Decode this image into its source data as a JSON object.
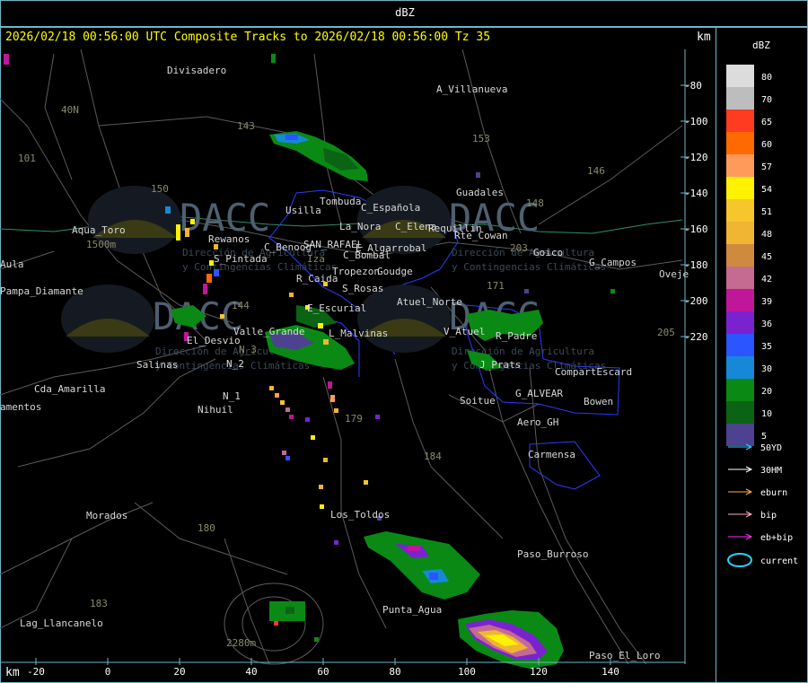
{
  "window": {
    "title": "dBZ"
  },
  "header": {
    "text": "2026/02/18 00:56:00 UTC Composite Tracks to 2026/02/18 00:56:00 Tz 35",
    "km_top": "km",
    "km_bottom": "km"
  },
  "axes": {
    "y_ticks": [
      "-80",
      "-100",
      "-120",
      "-140",
      "-160",
      "-180",
      "-200",
      "-220"
    ],
    "x_ticks": [
      "-20",
      "0",
      "20",
      "40",
      "60",
      "80",
      "100",
      "120",
      "140"
    ]
  },
  "watermark": {
    "name": "DACC",
    "line1": "Dirección de Agricultura",
    "line2": "y Contingencias Climáticas"
  },
  "place_labels": [
    "Divisadero",
    "A_Villanueva",
    "Guadales",
    "La_Nora",
    "C_Española",
    "C_Elena",
    "Requillin",
    "Rte_Cowan",
    "Usilla",
    "Tombuda",
    "Aqua_Toro",
    "Rewanos",
    "S_Pintada",
    "C_Benoog",
    "SAN_RAFAEL",
    "E_Algarrobal",
    "C_Bombal",
    "Goico",
    "G_Campos",
    "Oveje",
    "Pampa_Diamante",
    "Aula",
    "Tropezon",
    "Goudge",
    "R_Caida",
    "S_Rosas",
    "Atuel_Norte",
    "E_Escurial",
    "Valle_Grande",
    "El_Desvio",
    "L_Malvinas",
    "V_Atuel",
    "R_Padre",
    "J_Prats",
    "CompartEscard",
    "Salinas",
    "N_2",
    "N_1",
    "Cda_Amarilla",
    "amentos",
    "Nihuil",
    "G_ALVEAR",
    "Soitue",
    "Bowen",
    "Aero_GH",
    "Carmensa",
    "Morados",
    "Los_Toldos",
    "Paso_Burroso",
    "Punta_Agua",
    "Lag_Llancanelo",
    "Paso_El_Loro",
    "40N",
    "101",
    "153",
    "146",
    "143",
    "171",
    "205",
    "184",
    "180",
    "183",
    "150",
    "148",
    "203",
    "144",
    "179",
    "2280m",
    "1500m",
    "N_3",
    "Iza"
  ],
  "legend": {
    "title": "dBZ",
    "bins": [
      {
        "label": "80",
        "color": "#dcdcdc"
      },
      {
        "label": "70",
        "color": "#bdbdbd"
      },
      {
        "label": "65",
        "color": "#ff3b22"
      },
      {
        "label": "60",
        "color": "#ff6a00"
      },
      {
        "label": "57",
        "color": "#ff9a5a"
      },
      {
        "label": "54",
        "color": "#fff200"
      },
      {
        "label": "51",
        "color": "#f7c52c"
      },
      {
        "label": "48",
        "color": "#f0b533"
      },
      {
        "label": "45",
        "color": "#cf8a3e"
      },
      {
        "label": "42",
        "color": "#c56a90"
      },
      {
        "label": "39",
        "color": "#c0169a"
      },
      {
        "label": "36",
        "color": "#7a22d0"
      },
      {
        "label": "35",
        "color": "#2a55ff"
      },
      {
        "label": "30",
        "color": "#1688d8"
      },
      {
        "label": "20",
        "color": "#0a8a14"
      },
      {
        "label": "10",
        "color": "#0b6414"
      },
      {
        "label": "5",
        "color": "#4e4290"
      }
    ],
    "tracks": [
      {
        "label": "50YD",
        "color": "#26d4ff"
      },
      {
        "label": "30HM",
        "color": "#ffffff"
      },
      {
        "label": "eburn",
        "color": "#ffb23a"
      },
      {
        "label": "bip",
        "color": "#ffb0c8"
      },
      {
        "label": "eb+bip",
        "color": "#ff30ff"
      }
    ],
    "current_label": "current",
    "current_color": "#26d4ff"
  }
}
